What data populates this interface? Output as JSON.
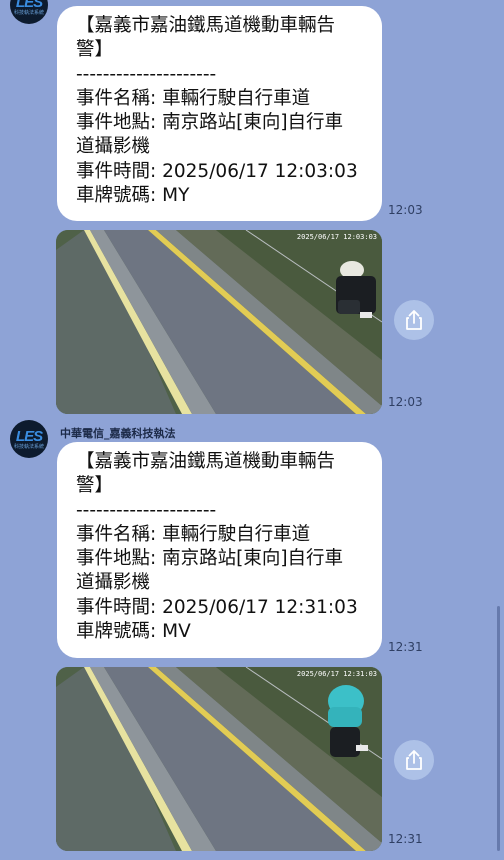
{
  "messages": [
    {
      "alert_title": "【嘉義市嘉油鐵馬道機動車輛告警】",
      "title_line1": "【嘉義市嘉油鐵馬道機動車輛告",
      "title_line2": "警】",
      "divider": "---------------------",
      "event_name": "事件名稱: 車輛行駛自行車道",
      "location_line1": "事件地點: 南京路站[東向]自行車",
      "location_line2": "道攝影機",
      "event_time": "事件時間: 2025/06/17 12:03:03",
      "plate": "車牌號碼: MY",
      "time": "12:03"
    },
    {
      "image_stamp": "2025/06/17 12:03:03",
      "time": "12:03",
      "share_icon": "share-icon"
    },
    {
      "sender": "中華電信_嘉義科技執法",
      "avatar_logo": "LES",
      "avatar_sub": "科技執法系統",
      "title_line1": "【嘉義市嘉油鐵馬道機動車輛告",
      "title_line2": "警】",
      "divider": "---------------------",
      "event_name": "事件名稱: 車輛行駛自行車道",
      "location_line1": "事件地點: 南京路站[東向]自行車",
      "location_line2": "道攝影機",
      "event_time": "事件時間: 2025/06/17 12:31:03",
      "plate": "車牌號碼: MV",
      "time": "12:31"
    },
    {
      "image_stamp": "2025/06/17 12:31:03",
      "time": "12:31",
      "share_icon": "share-icon"
    }
  ],
  "colors": {
    "background": "#8ea3d6",
    "bubble": "#ffffff",
    "timestamp": "#2f3f63"
  }
}
